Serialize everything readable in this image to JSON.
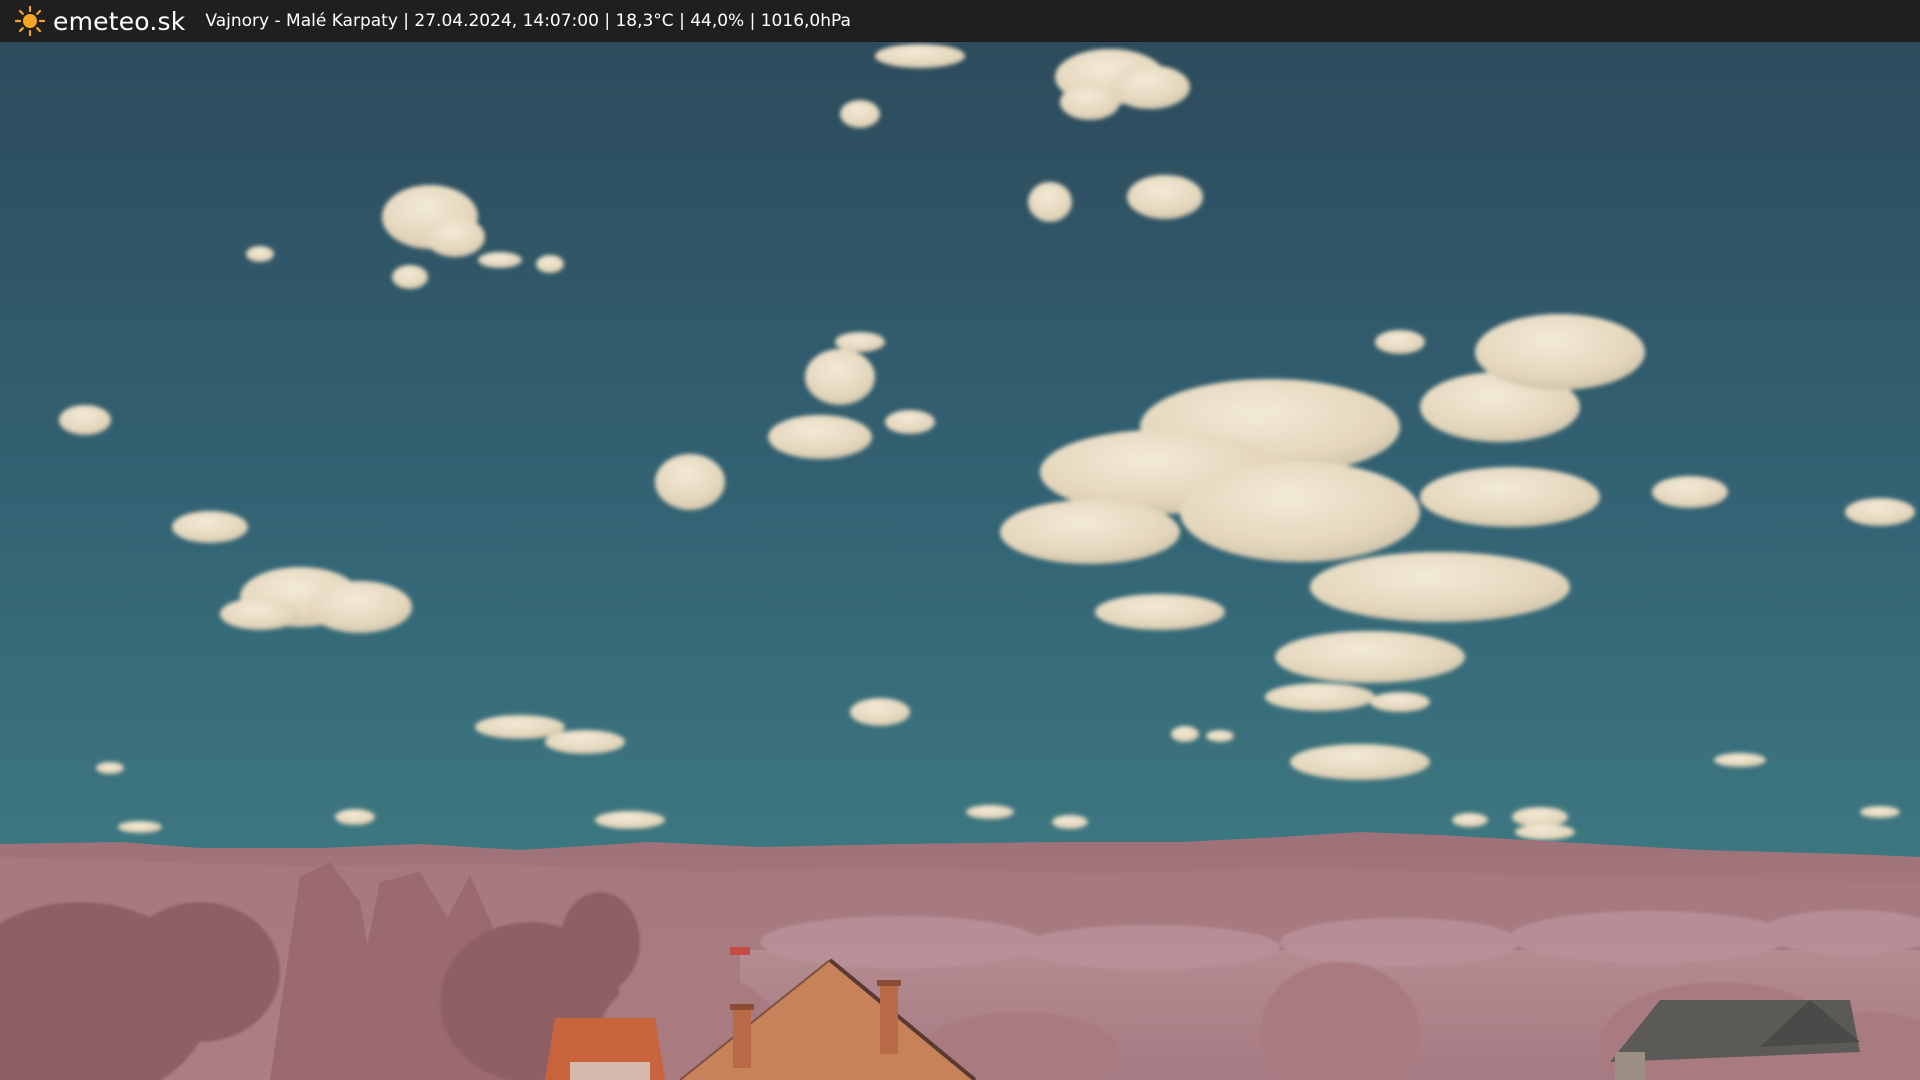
{
  "header": {
    "brand": "emeteo.sk",
    "caption": "Vajnory - Malé Karpaty | 27.04.2024, 14:07:00 | 18,3°C | 44,0% | 1016,0hPa",
    "logo_icon": "sun-icon"
  },
  "colors": {
    "bar": "#1f1f1f",
    "sun": "#f5a623",
    "sky_top": "#2f4f5f",
    "sky_bottom": "#3e7f86",
    "cloud": "#e8dcc4",
    "hills": "#a8757a",
    "foliage": "#9a6a6e",
    "roof": "#c9643a"
  }
}
